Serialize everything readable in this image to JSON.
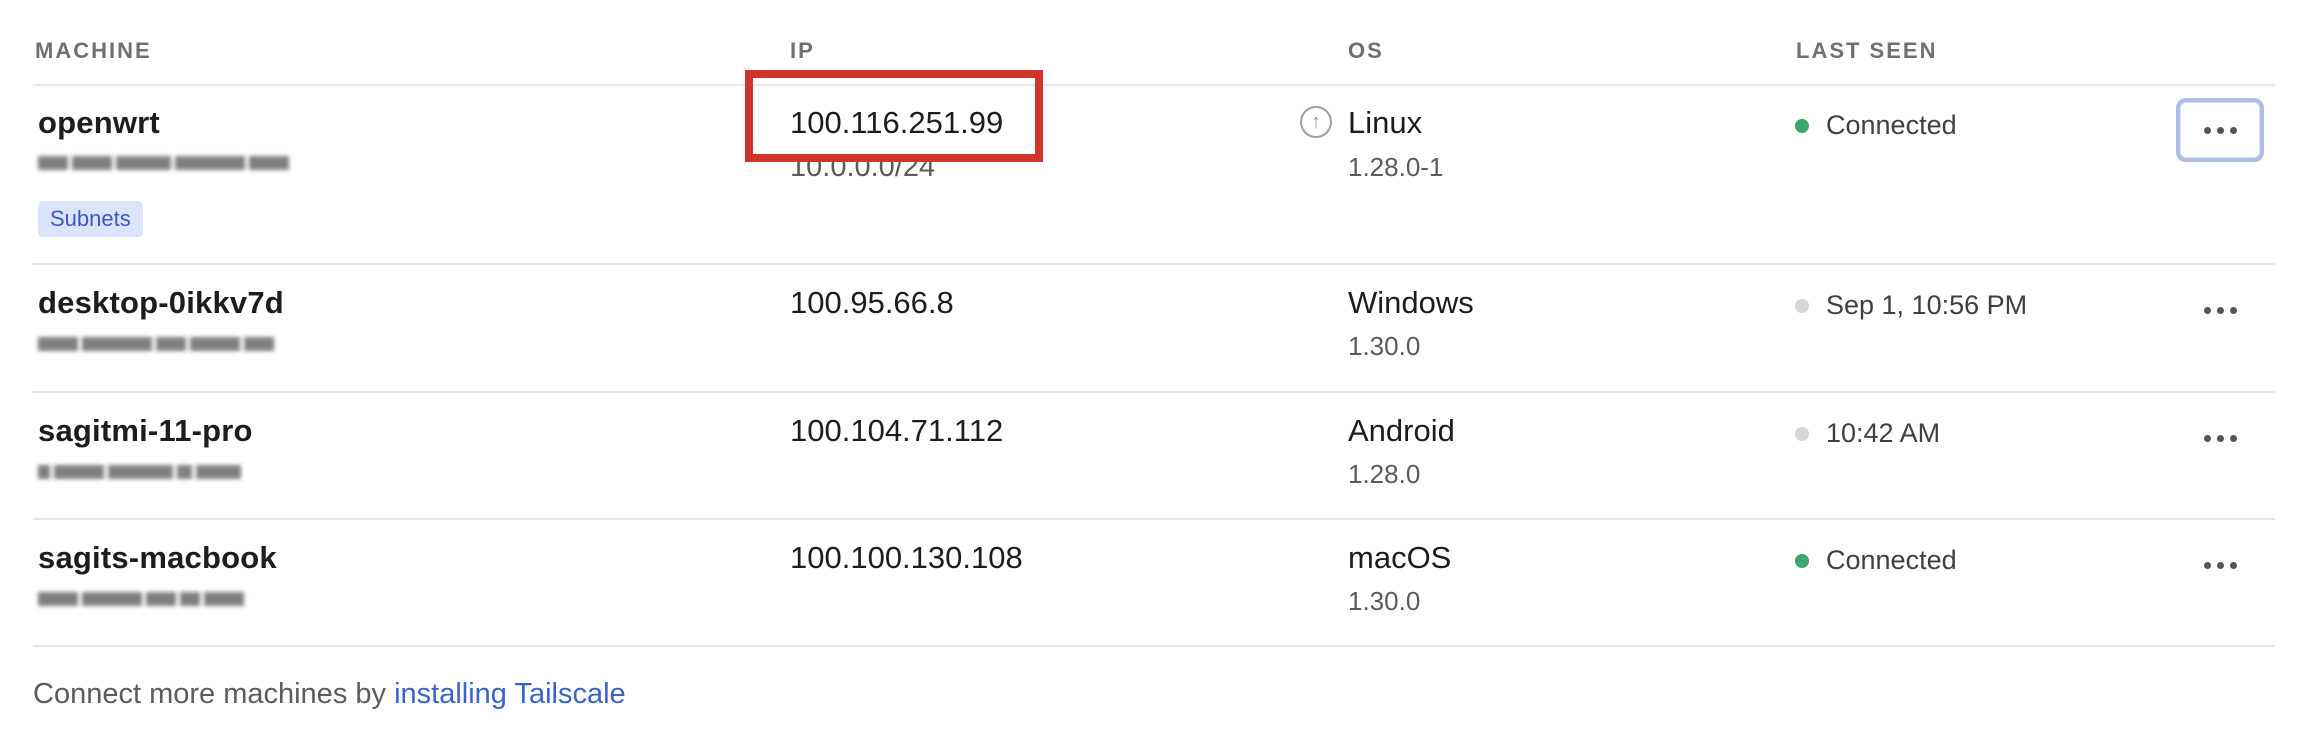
{
  "table": {
    "headers": {
      "machine": "MACHINE",
      "ip": "IP",
      "os": "OS",
      "last_seen": "LAST SEEN"
    },
    "rows": [
      {
        "name": "openwrt",
        "ip": "100.116.251.99",
        "subnet": "10.0.0.0/24",
        "badge": "Subnets",
        "os": "Linux",
        "version": "1.28.0-1",
        "status": "Connected",
        "status_color": "#3aa56c",
        "has_update": true
      },
      {
        "name": "desktop-0ikkv7d",
        "ip": "100.95.66.8",
        "os": "Windows",
        "version": "1.30.0",
        "status": "Sep 1, 10:56 PM",
        "status_color": "#d6d6d6"
      },
      {
        "name": "sagitmi-11-pro",
        "ip": "100.104.71.112",
        "os": "Android",
        "version": "1.28.0",
        "status": "10:42 AM",
        "status_color": "#d6d6d6"
      },
      {
        "name": "sagits-macbook",
        "ip": "100.100.130.108",
        "os": "macOS",
        "version": "1.30.0",
        "status": "Connected",
        "status_color": "#3aa56c"
      }
    ]
  },
  "footer": {
    "text": "Connect more machines by ",
    "link": "installing Tailscale"
  },
  "icons": {
    "row_menu": "more-horizontal-icon",
    "update": "arrow-up-circle-icon"
  },
  "colors": {
    "highlight": "#d0352b",
    "link": "#3a63c6",
    "badge_bg": "#dce4fb"
  }
}
